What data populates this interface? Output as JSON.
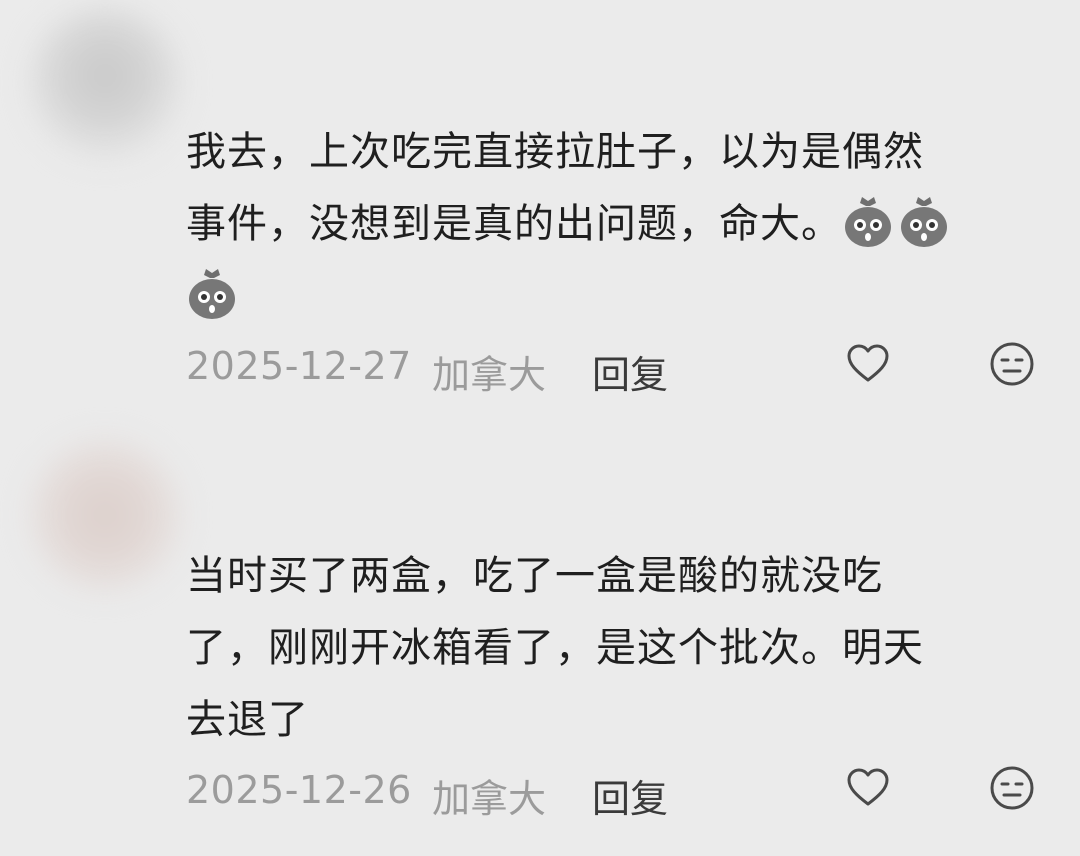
{
  "comments": [
    {
      "lines": [
        "我去，上次吃完直接拉肚子，以为是偶然",
        "事件，没想到是真的出问题，命大。"
      ],
      "trailing_emoji": [
        "shocked-money-bag-icon",
        "shocked-money-bag-icon",
        "shocked-money-bag-icon"
      ],
      "date": "2025-12-27",
      "location": "加拿大",
      "reply_label": "回复"
    },
    {
      "lines": [
        "当时买了两盒，吃了一盒是酸的就没吃",
        "了，刚刚开冰箱看了，是这个批次。明天",
        "去退了"
      ],
      "date": "2025-12-26",
      "location": "加拿大",
      "reply_label": "回复"
    }
  ],
  "colors": {
    "background": "#ebebeb",
    "text": "#1f1f1f",
    "meta": "#9b9b9b",
    "reply": "#3a3a3a"
  }
}
